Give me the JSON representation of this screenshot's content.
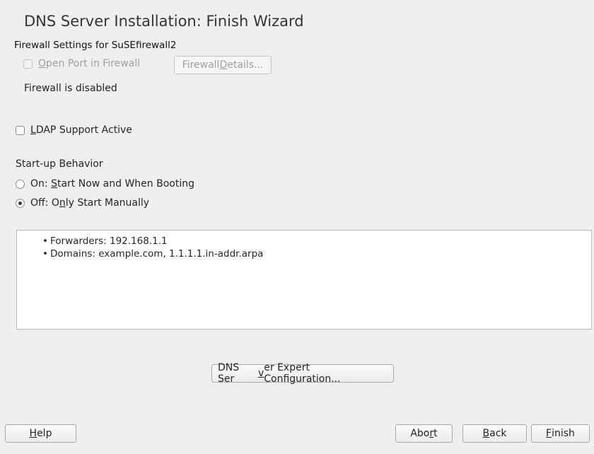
{
  "title": "DNS Server Installation: Finish Wizard",
  "firewall": {
    "section_label": "Firewall Settings for SuSEfirewall2",
    "open_port": {
      "u": "O",
      "rest": "pen Port in Firewall",
      "checked": false,
      "enabled": false
    },
    "details_button": {
      "pre": "Firewall ",
      "u": "D",
      "rest": "etails..."
    },
    "status": "Firewall is disabled"
  },
  "ldap": {
    "u": "L",
    "rest": "DAP Support Active",
    "checked": false
  },
  "startup": {
    "label": "Start-up Behavior",
    "on": {
      "pre": "On: ",
      "u": "S",
      "rest": "tart Now and When Booting",
      "selected": false
    },
    "off": {
      "pre": "Off: O",
      "u": "n",
      "rest": "ly Start Manually",
      "selected": true
    }
  },
  "summary": {
    "items": [
      "Forwarders: 192.168.1.1",
      "Domains: example.com, 1.1.1.1.in-addr.arpa"
    ]
  },
  "expert_button": {
    "pre": "DNS Ser",
    "u": "v",
    "rest": "er Expert Configuration..."
  },
  "footer": {
    "help": {
      "u": "H",
      "rest": "elp"
    },
    "abort": {
      "pre": "Abo",
      "u": "r",
      "rest": "t"
    },
    "back": {
      "u": "B",
      "rest": "ack"
    },
    "finish": {
      "u": "F",
      "rest": "inish"
    }
  }
}
